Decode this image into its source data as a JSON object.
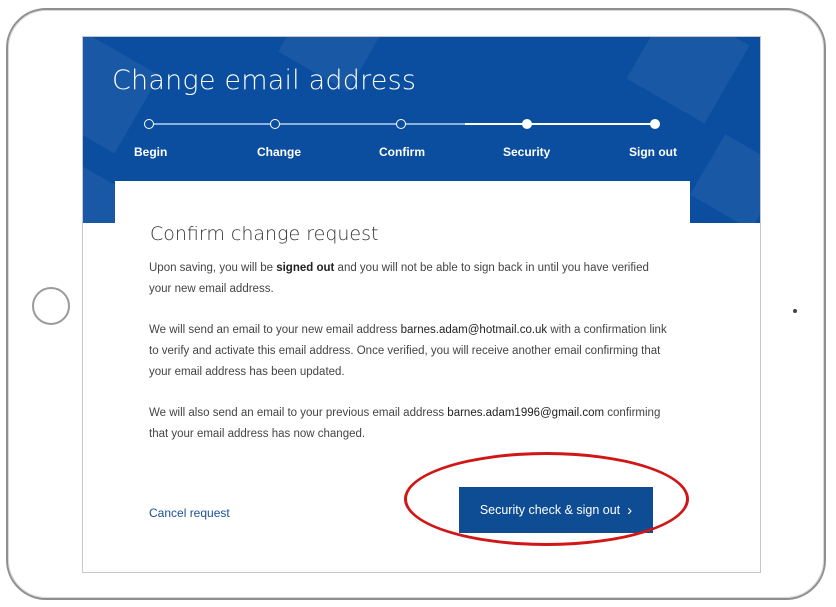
{
  "header": {
    "title": "Change email address",
    "steps": [
      {
        "label": "Begin",
        "state": "done"
      },
      {
        "label": "Change",
        "state": "done"
      },
      {
        "label": "Confirm",
        "state": "done"
      },
      {
        "label": "Security",
        "state": "active"
      },
      {
        "label": "Sign out",
        "state": "active"
      }
    ]
  },
  "card": {
    "title": "Confirm change request",
    "p1_before": "Upon saving, you will be ",
    "p1_bold": "signed out",
    "p1_after": " and you will not be able to sign back in until you have verified your new email address.",
    "p2_before": "We will send an email to your new email address ",
    "p2_email": "barnes.adam@hotmail.co.uk",
    "p2_after": " with a confirmation link to verify and activate this email address. Once verified, you will receive another email confirming that your email address has been updated.",
    "p3_before": "We will also send an email to your previous email address ",
    "p3_email": "barnes.adam1996@gmail.com",
    "p3_after": " confirming that your email address has now changed."
  },
  "actions": {
    "cancel_label": "Cancel request",
    "primary_label": "Security check & sign out",
    "primary_icon": "chevron-right-icon"
  },
  "colors": {
    "banner": "#0b4ea0",
    "button": "#0e4c93",
    "highlight": "#d01616",
    "link": "#1a4e9a"
  }
}
